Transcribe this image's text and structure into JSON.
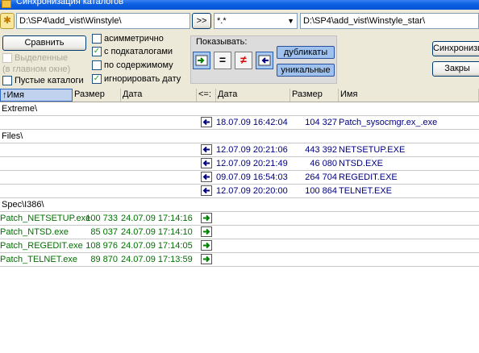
{
  "window": {
    "title": "Синхронизация каталогов"
  },
  "toolbar": {
    "left_path": "D:\\SP4\\add_vist\\Winstyle\\",
    "swap_label": ">>",
    "mask": "*.*",
    "right_path": "D:\\SP4\\add_vist\\Winstyle_star\\"
  },
  "options": {
    "compare_label": "Сравнить",
    "selected_only_label": "Выделенные",
    "in_main_window_label": "(в главном окне)",
    "empty_dirs_label": "Пустые каталоги",
    "asymmetric_label": "асимметрично",
    "subdirs_label": "с подкаталогами",
    "by_content_label": "по содержимому",
    "ignore_date_label": "игнорировать дату",
    "asymmetric": false,
    "subdirs": true,
    "by_content": false,
    "ignore_date": true,
    "empty_dirs": false
  },
  "show": {
    "label": "Показывать:",
    "eq_glyph": "=",
    "neq_glyph": "≠",
    "duplicates_label": "дубликаты",
    "unique_label": "уникальные"
  },
  "actions": {
    "sync_label": "Синхронизи",
    "close_label": "Закры"
  },
  "columns": {
    "left_name": "Имя",
    "left_size": "Размер",
    "left_date": "Дата",
    "direction": "<=:",
    "right_date": "Дата",
    "right_size": "Размер",
    "right_name": "Имя"
  },
  "groups": [
    {
      "title": "Extreme\\",
      "rows": [
        {
          "side": "right",
          "date": "18.07.09 16:42:04",
          "size": "104 327",
          "name": "Patch_sysocmgr.ex_.exe"
        }
      ]
    },
    {
      "title": "Files\\",
      "rows": [
        {
          "side": "right",
          "date": "12.07.09 20:21:06",
          "size": "443 392",
          "name": "NETSETUP.EXE"
        },
        {
          "side": "right",
          "date": "12.07.09 20:21:49",
          "size": "46 080",
          "name": "NTSD.EXE"
        },
        {
          "side": "right",
          "date": "09.07.09 16:54:03",
          "size": "264 704",
          "name": "REGEDIT.EXE"
        },
        {
          "side": "right",
          "date": "12.07.09 20:20:00",
          "size": "100 864",
          "name": "TELNET.EXE"
        }
      ]
    },
    {
      "title": "Spec\\I386\\",
      "rows": [
        {
          "side": "left",
          "name": "Patch_NETSETUP.exe",
          "size": "100 733",
          "date": "24.07.09 17:14:16"
        },
        {
          "side": "left",
          "name": "Patch_NTSD.exe",
          "size": "85 037",
          "date": "24.07.09 17:14:10"
        },
        {
          "side": "left",
          "name": "Patch_REGEDIT.exe",
          "size": "108 976",
          "date": "24.07.09 17:14:05"
        },
        {
          "side": "left",
          "name": "Patch_TELNET.exe",
          "size": "89 870",
          "date": "24.07.09 17:13:59"
        }
      ]
    }
  ],
  "colors": {
    "right_only": "#000080",
    "left_only": "#007000"
  }
}
